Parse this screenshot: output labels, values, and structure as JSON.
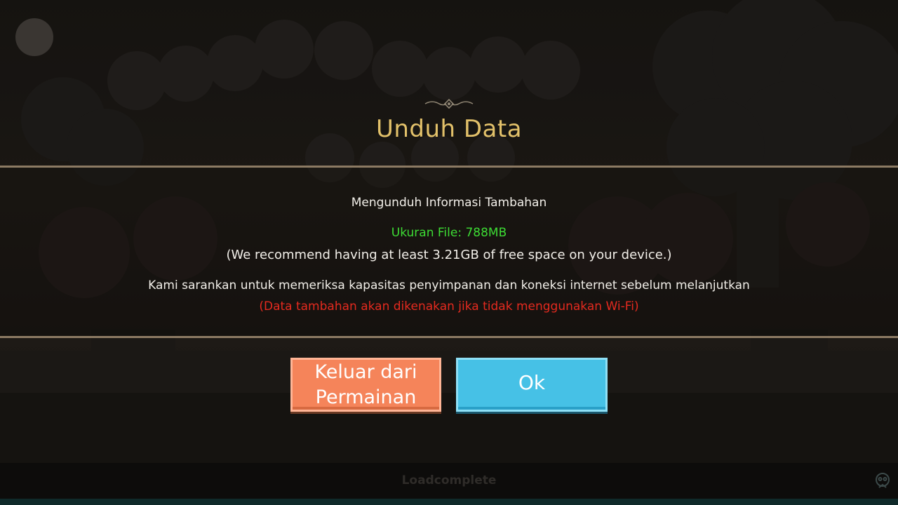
{
  "dialog": {
    "title": "Unduh Data",
    "heading": "Mengunduh Informasi Tambahan",
    "file_size": "Ukuran File: 788MB",
    "recommendation": "(We recommend having at least 3.21GB of free space on your device.)",
    "advice": "Kami sarankan untuk memeriksa kapasitas penyimpanan dan koneksi internet sebelum melanjutkan",
    "warning": "(Data tambahan akan dikenakan jika tidak menggunakan Wi-Fi)"
  },
  "buttons": {
    "exit_label": "Keluar dari\nPermainan",
    "ok_label": "Ok"
  },
  "status": {
    "text": "Loadcomplete"
  },
  "colors": {
    "title": "#e2c16a",
    "file_size": "#3ddc34",
    "warning": "#e52a1f",
    "exit_button": "#f5845a",
    "ok_button": "#46c1e6"
  },
  "icons": {
    "top_left": "circle-button-icon",
    "ornament": "ornament-divider-icon",
    "corner": "recorder-logo-icon"
  }
}
